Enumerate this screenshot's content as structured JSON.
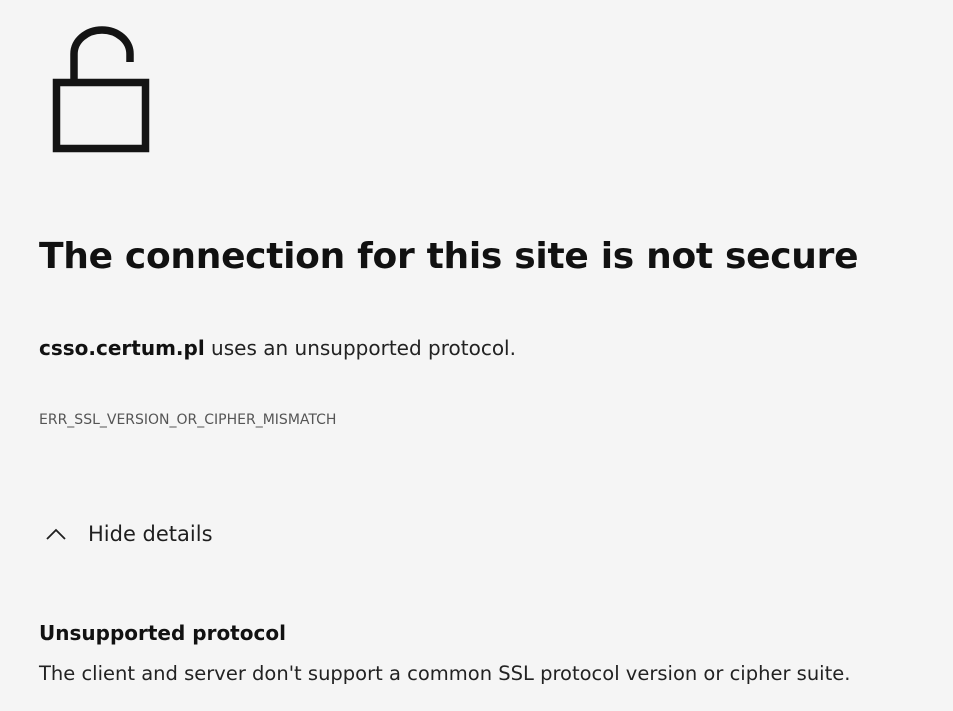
{
  "error": {
    "title": "The connection for this site is not secure",
    "host": "csso.certum.pl",
    "description_suffix": " uses an unsupported protocol.",
    "code": "ERR_SSL_VERSION_OR_CIPHER_MISMATCH",
    "icon": "unlocked-padlock-icon"
  },
  "details": {
    "toggle_label": "Hide details",
    "toggle_icon": "chevron-up-icon",
    "heading": "Unsupported protocol",
    "body": "The client and server don't support a common SSL protocol version or cipher suite."
  },
  "colors": {
    "background": "#f5f5f5",
    "text": "#111111",
    "muted": "#555555"
  }
}
